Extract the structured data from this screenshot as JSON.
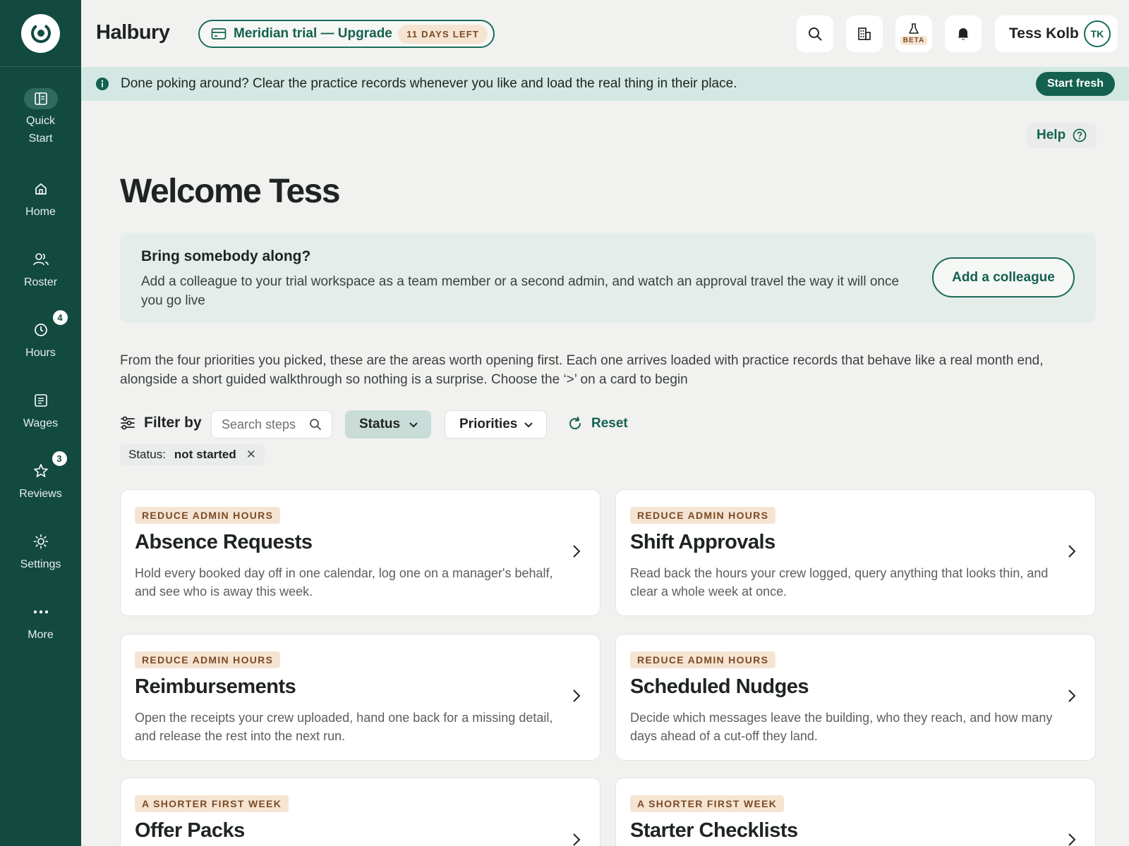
{
  "app": {
    "brand": "Halbury"
  },
  "trial": {
    "label": "Meridian trial — Upgrade",
    "days_left": "11 DAYS LEFT"
  },
  "header": {
    "beta_label": "BETA",
    "user_name": "Tess Kolb",
    "user_initials": "TK"
  },
  "sidebar": {
    "items": [
      {
        "label": "Quick Start",
        "icon": "quick-start-icon"
      },
      {
        "label": "Home",
        "icon": "home-icon"
      },
      {
        "label": "Roster",
        "icon": "people-icon"
      },
      {
        "label": "Hours",
        "icon": "clock-icon",
        "badge": "4"
      },
      {
        "label": "Wages",
        "icon": "document-icon"
      },
      {
        "label": "Reviews",
        "icon": "star-icon",
        "badge": "3"
      },
      {
        "label": "Settings",
        "icon": "sun-gear-icon"
      },
      {
        "label": "More",
        "icon": "more-dots-icon"
      }
    ]
  },
  "banner": {
    "text": "Done poking around? Clear the practice records whenever you like and load the real thing in their place.",
    "button": "Start fresh"
  },
  "help": {
    "label": "Help"
  },
  "welcome": "Welcome Tess",
  "invite": {
    "title": "Bring somebody along?",
    "body": "Add a colleague to your trial workspace as a team member or a second admin, and watch an approval travel the way it will once you go live",
    "button": "Add a colleague"
  },
  "intro": "From the four priorities you picked, these are the areas worth opening first. Each one arrives loaded with practice records that behave like a real month end, alongside a short guided walkthrough so nothing is a surprise. Choose the ‘>’ on a card to begin",
  "filters": {
    "label": "Filter by",
    "search_placeholder": "Search steps",
    "status_label": "Status",
    "priorities_label": "Priorities",
    "reset_label": "Reset",
    "active_chip": {
      "key": "Status:",
      "value": "not started"
    }
  },
  "cards": [
    {
      "tag": "REDUCE ADMIN HOURS",
      "title": "Absence Requests",
      "desc": "Hold every booked day off in one calendar, log one on a manager's behalf, and see who is away this week."
    },
    {
      "tag": "REDUCE ADMIN HOURS",
      "title": "Shift Approvals",
      "desc": "Read back the hours your crew logged, query anything that looks thin, and clear a whole week at once."
    },
    {
      "tag": "REDUCE ADMIN HOURS",
      "title": "Reimbursements",
      "desc": "Open the receipts your crew uploaded, hand one back for a missing detail, and release the rest into the next run."
    },
    {
      "tag": "REDUCE ADMIN HOURS",
      "title": "Scheduled Nudges",
      "desc": "Decide which messages leave the building, who they reach, and how many days ahead of a cut-off they land."
    },
    {
      "tag": "A SHORTER FIRST WEEK",
      "title": "Offer Packs",
      "desc": ""
    },
    {
      "tag": "A SHORTER FIRST WEEK",
      "title": "Starter Checklists",
      "desc": ""
    }
  ],
  "colors": {
    "sidebar": "#134a40",
    "accent": "#14614f",
    "banner": "#d3e8e3",
    "tag_bg": "#f6e4d3",
    "tag_text": "#7a4a24"
  }
}
